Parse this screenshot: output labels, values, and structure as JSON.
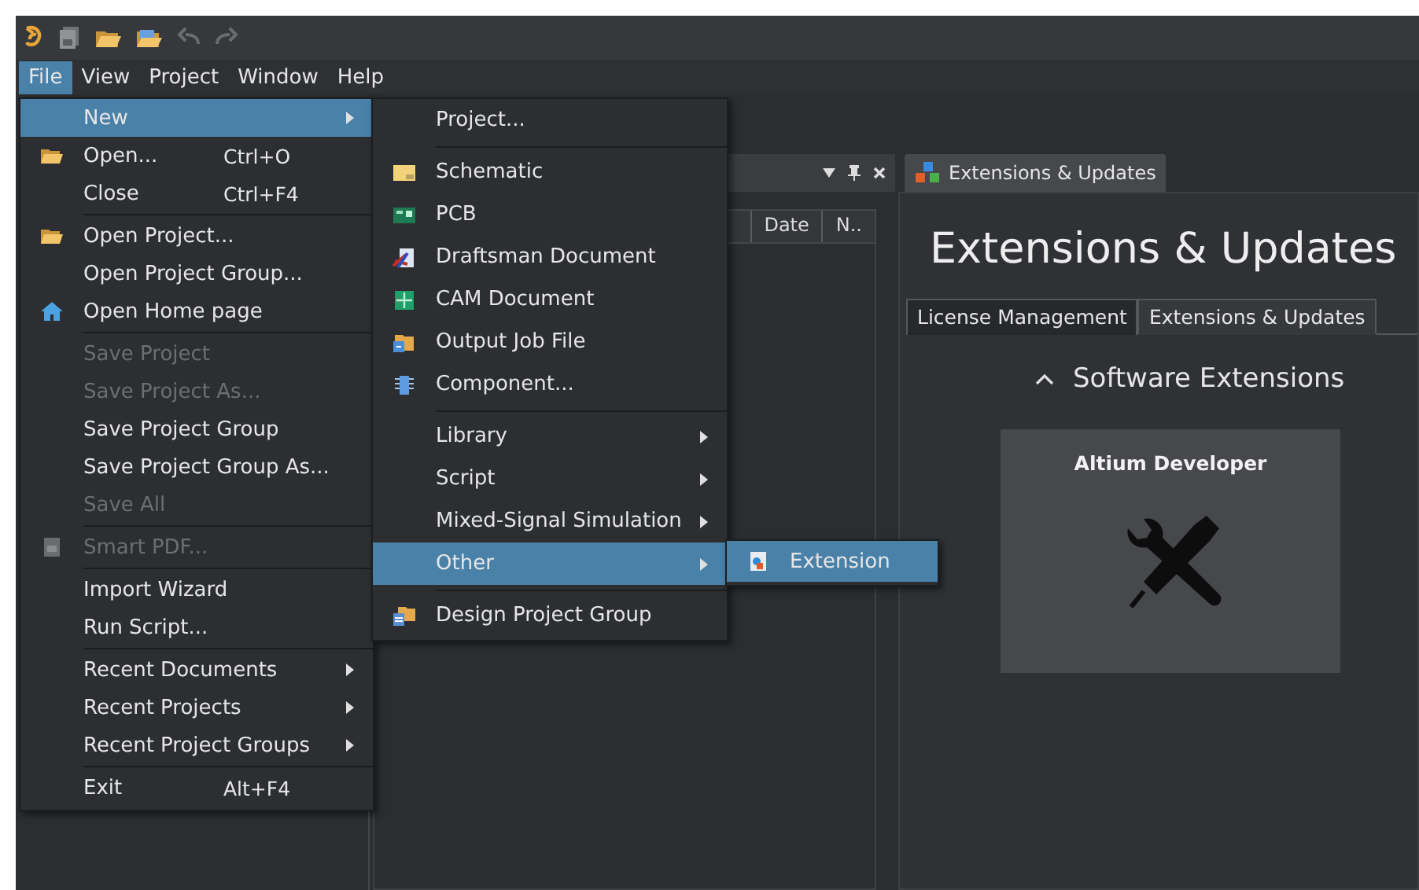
{
  "menubar": [
    {
      "label": "File",
      "selected": true
    },
    {
      "label": "View",
      "selected": false
    },
    {
      "label": "Project",
      "selected": false
    },
    {
      "label": "Window",
      "selected": false
    },
    {
      "label": "Help",
      "selected": false
    }
  ],
  "file_menu": [
    {
      "kind": "item",
      "label": "New",
      "selected": true,
      "disabled": false,
      "submenu": true
    },
    {
      "kind": "item",
      "label": "Open...",
      "shortcut": "Ctrl+O",
      "selected": false,
      "disabled": false,
      "submenu": false
    },
    {
      "kind": "item",
      "label": "Close",
      "shortcut": "Ctrl+F4",
      "selected": false,
      "disabled": false,
      "submenu": false
    },
    {
      "kind": "separator"
    },
    {
      "kind": "item",
      "label": "Open Project...",
      "selected": false,
      "disabled": false,
      "submenu": false
    },
    {
      "kind": "item",
      "label": "Open Project Group...",
      "selected": false,
      "disabled": false,
      "submenu": false
    },
    {
      "kind": "item",
      "label": "Open Home page",
      "selected": false,
      "disabled": false,
      "submenu": false
    },
    {
      "kind": "separator"
    },
    {
      "kind": "item",
      "label": "Save Project",
      "selected": false,
      "disabled": true,
      "submenu": false
    },
    {
      "kind": "item",
      "label": "Save Project As...",
      "selected": false,
      "disabled": true,
      "submenu": false
    },
    {
      "kind": "item",
      "label": "Save Project Group",
      "selected": false,
      "disabled": false,
      "submenu": false
    },
    {
      "kind": "item",
      "label": "Save Project Group As...",
      "selected": false,
      "disabled": false,
      "submenu": false
    },
    {
      "kind": "item",
      "label": "Save All",
      "selected": false,
      "disabled": true,
      "submenu": false
    },
    {
      "kind": "separator"
    },
    {
      "kind": "item",
      "label": "Smart PDF...",
      "selected": false,
      "disabled": true,
      "submenu": false
    },
    {
      "kind": "separator"
    },
    {
      "kind": "item",
      "label": "Import Wizard",
      "selected": false,
      "disabled": false,
      "submenu": false
    },
    {
      "kind": "item",
      "label": "Run Script...",
      "selected": false,
      "disabled": false,
      "submenu": false
    },
    {
      "kind": "separator"
    },
    {
      "kind": "item",
      "label": "Recent Documents",
      "selected": false,
      "disabled": false,
      "submenu": true
    },
    {
      "kind": "item",
      "label": "Recent Projects",
      "selected": false,
      "disabled": false,
      "submenu": true
    },
    {
      "kind": "item",
      "label": "Recent Project Groups",
      "selected": false,
      "disabled": false,
      "submenu": true
    },
    {
      "kind": "separator"
    },
    {
      "kind": "item",
      "label": "Exit",
      "shortcut": "Alt+F4",
      "selected": false,
      "disabled": false,
      "submenu": false
    }
  ],
  "new_menu": [
    {
      "kind": "item",
      "label": "Project...",
      "selected": false,
      "submenu": false
    },
    {
      "kind": "separator"
    },
    {
      "kind": "item",
      "label": "Schematic",
      "selected": false,
      "submenu": false
    },
    {
      "kind": "item",
      "label": "PCB",
      "selected": false,
      "submenu": false
    },
    {
      "kind": "item",
      "label": "Draftsman Document",
      "selected": false,
      "submenu": false
    },
    {
      "kind": "item",
      "label": "CAM Document",
      "selected": false,
      "submenu": false
    },
    {
      "kind": "item",
      "label": "Output Job File",
      "selected": false,
      "submenu": false
    },
    {
      "kind": "item",
      "label": "Component...",
      "selected": false,
      "submenu": false
    },
    {
      "kind": "separator"
    },
    {
      "kind": "item",
      "label": "Library",
      "selected": false,
      "submenu": true
    },
    {
      "kind": "item",
      "label": "Script",
      "selected": false,
      "submenu": true
    },
    {
      "kind": "item",
      "label": "Mixed-Signal Simulation",
      "selected": false,
      "submenu": true
    },
    {
      "kind": "item",
      "label": "Other",
      "selected": true,
      "submenu": true
    },
    {
      "kind": "separator"
    },
    {
      "kind": "item",
      "label": "Design Project Group",
      "selected": false,
      "submenu": false
    }
  ],
  "other_menu": [
    {
      "kind": "item",
      "label": "Extension",
      "selected": true,
      "submenu": false
    }
  ],
  "panel": {
    "columns": [
      "Date",
      "N.."
    ]
  },
  "document": {
    "tab": "Extensions & Updates",
    "heading": "Extensions & Updates",
    "tabs": [
      {
        "label": "License Management",
        "selected": false
      },
      {
        "label": "Extensions & Updates",
        "selected": true
      }
    ],
    "section": {
      "title": "Software Extensions",
      "expanded": true
    },
    "cards": [
      {
        "title": "Altium Developer"
      }
    ]
  }
}
